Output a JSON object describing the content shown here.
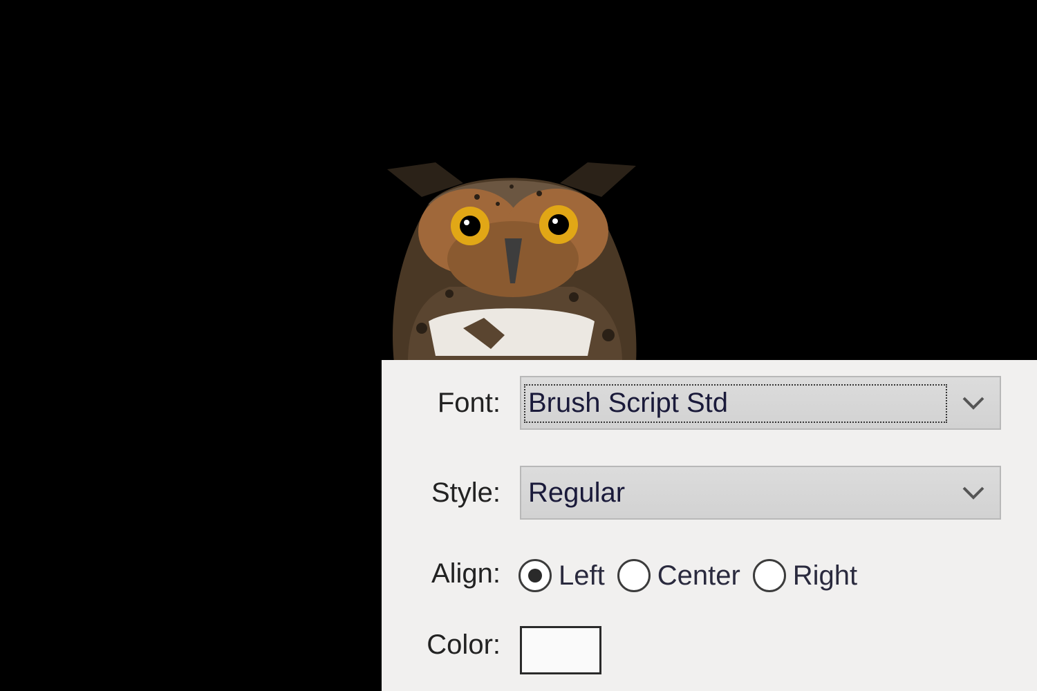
{
  "photo": {
    "subject": "owl",
    "background_color": "#000000"
  },
  "panel": {
    "font": {
      "label": "Font:",
      "value": "Brush Script Std",
      "icon": "chevron-down-icon"
    },
    "style": {
      "label": "Style:",
      "value": "Regular",
      "icon": "chevron-down-icon"
    },
    "align": {
      "label": "Align:",
      "options": [
        {
          "label": "Left",
          "selected": true
        },
        {
          "label": "Center",
          "selected": false
        },
        {
          "label": "Right",
          "selected": false
        }
      ]
    },
    "color": {
      "label": "Color:",
      "value": "#fafafa"
    }
  }
}
